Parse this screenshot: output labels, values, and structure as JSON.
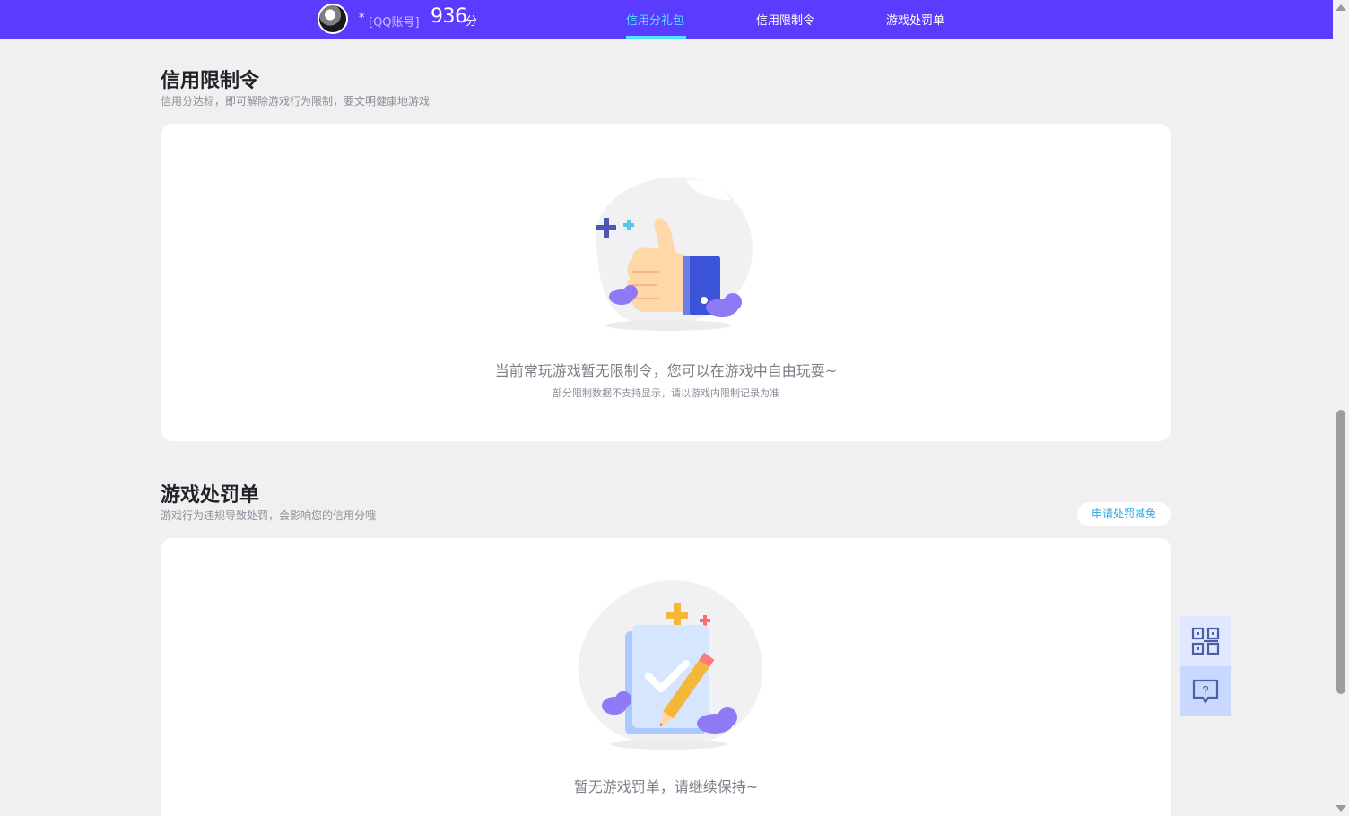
{
  "header": {
    "account_prefix": "*",
    "account_type": "[QQ账号]",
    "score": "936",
    "score_unit": "分",
    "nav": [
      {
        "label": "信用分礼包",
        "active": true
      },
      {
        "label": "信用限制令",
        "active": false
      },
      {
        "label": "游戏处罚单",
        "active": false
      }
    ]
  },
  "restriction": {
    "title": "信用限制令",
    "subtitle": "信用分达标，即可解除游戏行为限制，要文明健康地游戏",
    "empty_message": "当前常玩游戏暂无限制令，您可以在游戏中自由玩耍~",
    "empty_note": "部分限制数据不支持显示，请以游戏内限制记录为准"
  },
  "penalty": {
    "title": "游戏处罚单",
    "subtitle": "游戏行为违规导致处罚，会影响您的信用分哦",
    "appeal_button": "申请处罚减免",
    "empty_message": "暂无游戏罚单，请继续保持~"
  },
  "floating": {
    "qr_icon": "qr-code-icon",
    "help_icon": "help-chat-icon"
  },
  "colors": {
    "topbar": "#5b3cff",
    "nav_active": "#4fe3ff",
    "appeal_text": "#2fa7e0"
  }
}
